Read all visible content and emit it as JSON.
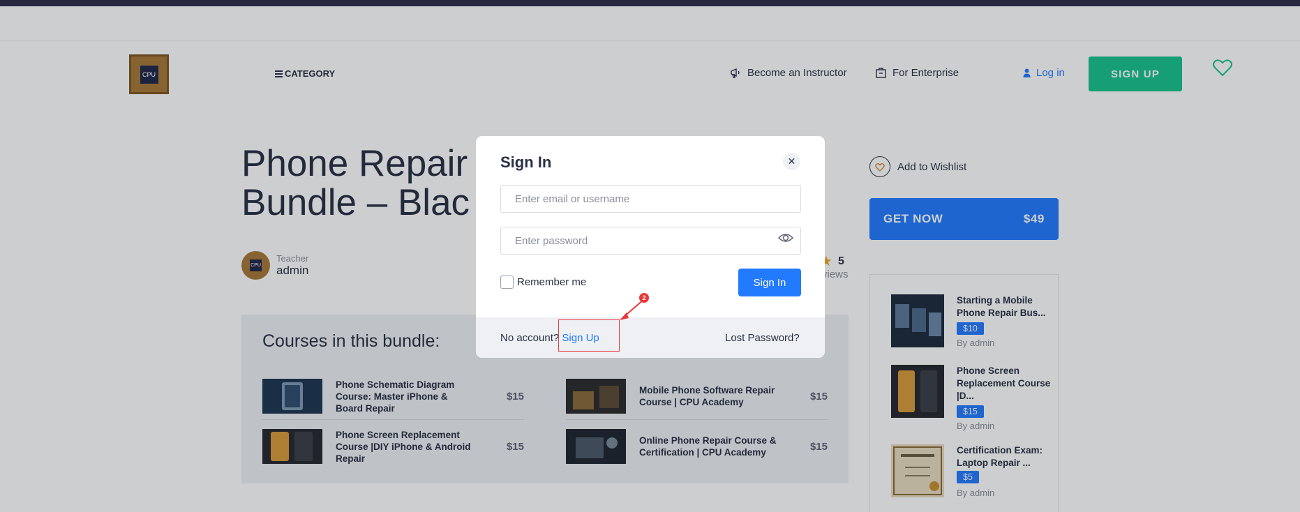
{
  "header": {
    "logo_text": "CPU",
    "category_label": "CATEGORY",
    "become_instructor_label": "Become an Instructor",
    "for_enterprise_label": "For Enterprise",
    "login_label": "Log in",
    "signup_label": "SIGN UP"
  },
  "course": {
    "title_line1": "Phone Repair",
    "title_line2": "Bundle – Blac",
    "teacher_role": "Teacher",
    "teacher_name": "admin",
    "avatar_text": "CPU",
    "rating_value": "5",
    "reviews_label": "views"
  },
  "bundle": {
    "title": "Courses in this bundle:",
    "courses": [
      {
        "name": "Phone Schematic Diagram Course: Master iPhone & Board Repair",
        "price": "$15"
      },
      {
        "name": "Mobile Phone Software Repair Course | CPU Academy",
        "price": "$15"
      },
      {
        "name": "Phone Screen Replacement Course |DIY iPhone & Android Repair",
        "price": "$15"
      },
      {
        "name": "Online Phone Repair Course & Certification | CPU Academy",
        "price": "$15"
      }
    ]
  },
  "sidebar": {
    "wishlist_label": "Add to Wishlist",
    "get_now_label": "GET NOW",
    "get_now_price": "$49",
    "related": [
      {
        "name": "Starting a Mobile Phone Repair Bus...",
        "price": "$10",
        "by": "By admin"
      },
      {
        "name": "Phone Screen Replacement Course |D...",
        "price": "$15",
        "by": "By admin"
      },
      {
        "name": "Certification Exam: Laptop Repair ...",
        "price": "$5",
        "by": "By admin"
      }
    ]
  },
  "modal": {
    "title": "Sign In",
    "email_placeholder": "Enter email or username",
    "password_placeholder": "Enter password",
    "remember_label": "Remember me",
    "signin_label": "Sign In",
    "no_account_label": "No account?",
    "signup_link_label": "Sign Up",
    "lost_password_label": "Lost Password?"
  },
  "annotation": {
    "marker_number": "2"
  },
  "colors": {
    "accent_blue": "#227aff",
    "signup_green": "#17c38d",
    "annotation_red": "#e8383d",
    "text_dark": "#273044"
  }
}
